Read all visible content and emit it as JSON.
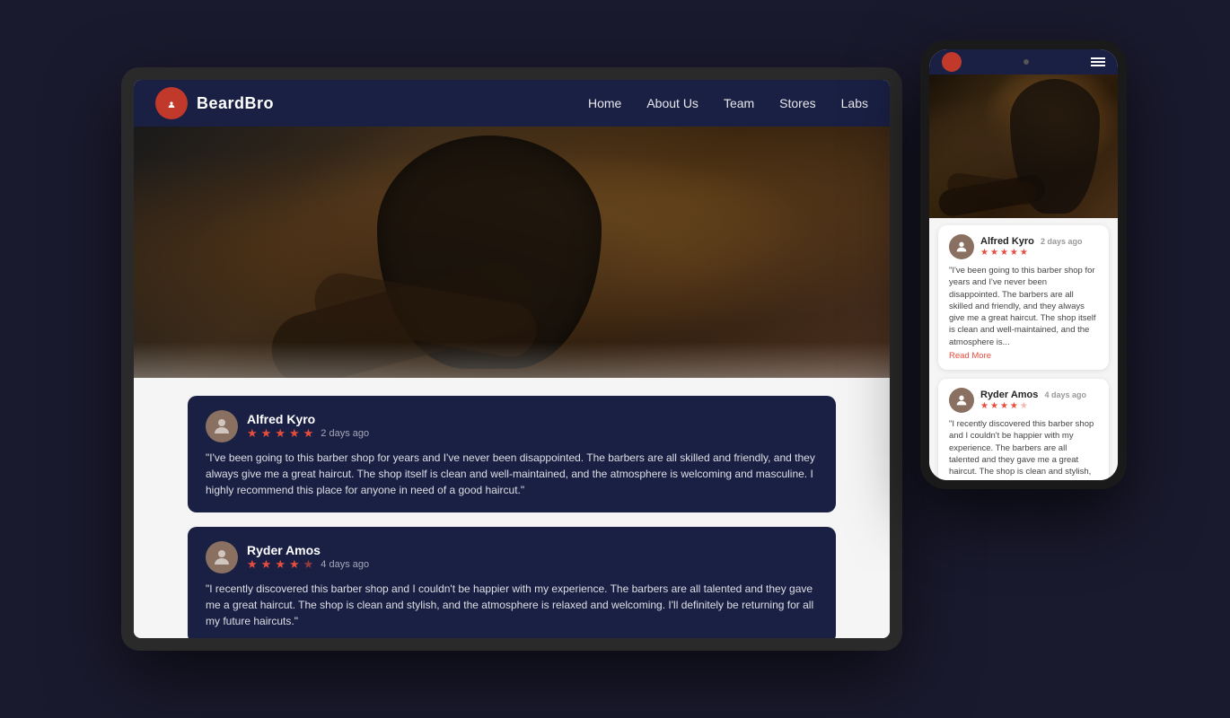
{
  "app": {
    "name": "BeardBro",
    "logo_symbol": "✂"
  },
  "nav": {
    "links": [
      {
        "label": "Home",
        "id": "home"
      },
      {
        "label": "About Us",
        "id": "about"
      },
      {
        "label": "Team",
        "id": "team"
      },
      {
        "label": "Stores",
        "id": "stores"
      },
      {
        "label": "Labs",
        "id": "labs"
      }
    ]
  },
  "reviews": [
    {
      "name": "Alfred Kyro",
      "time_ago": "2 days ago",
      "stars": 5,
      "text": "\"I've been going to this barber shop for years and I've never been disappointed. The barbers are all skilled and friendly, and they always give me a great haircut. The shop itself is clean and well-maintained, and the atmosphere is welcoming and masculine. I highly recommend this place for anyone in need of a good haircut.\""
    },
    {
      "name": "Ryder Amos",
      "time_ago": "4 days ago",
      "stars": 4,
      "text": "\"I recently discovered this barber shop and I couldn't be happier with my experience. The barbers are all talented and they gave me a great haircut. The shop is clean and stylish, and the atmosphere is relaxed and welcoming. I'll definitely be returning for all my future haircuts.\""
    }
  ],
  "phone_reviews": [
    {
      "name": "Alfred Kyro",
      "time_ago": "2 days ago",
      "stars": 5,
      "text": "\"I've been going to this barber shop for years and I've never been disappointed. The barbers are all skilled and friendly, and they always give me a great haircut. The shop itself is clean and well-maintained, and the atmosphere is...",
      "read_more": "Read More"
    },
    {
      "name": "Ryder Amos",
      "time_ago": "4 days ago",
      "stars": 4,
      "text": "\"I recently discovered this barber shop and I couldn't be happier with my experience. The barbers are all talented and they gave me a great haircut. The shop is clean and stylish, and the atmosphere is relaxed and welcoming. I'll definitely be returning for all my future"
    }
  ]
}
